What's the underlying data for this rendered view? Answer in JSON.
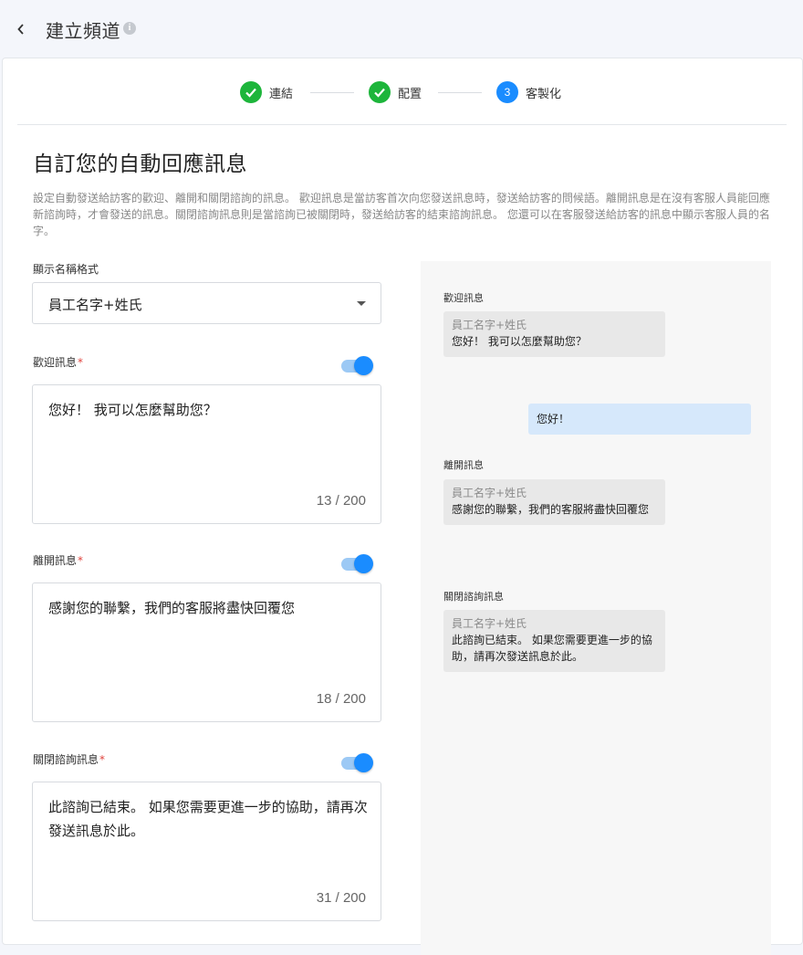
{
  "header": {
    "title": "建立頻道",
    "back_icon": "chevron-left-icon",
    "info_icon": "info-icon"
  },
  "stepper": {
    "steps": [
      {
        "label": "連結",
        "state": "done"
      },
      {
        "label": "配置",
        "state": "done"
      },
      {
        "label": "客製化",
        "state": "active",
        "number": "3"
      }
    ],
    "done_color": "#1db53b",
    "active_color": "#1a8cff"
  },
  "main": {
    "title": "自訂您的自動回應訊息",
    "description": "設定自動發送給訪客的歡迎、離開和關閉諮詢的訊息。 歡迎訊息是當訪客首次向您發送訊息時，發送給訪客的問候語。離開訊息是在沒有客服人員能回應新諮詢時，才會發送的訊息。關閉諮詢訊息則是當諮詢已被關閉時，發送給訪客的結束諮詢訊息。 您還可以在客服發送給訪客的訊息中顯示客服人員的名字。"
  },
  "form": {
    "display_name": {
      "label": "顯示名稱格式",
      "value": "員工名字+姓氏"
    },
    "welcome": {
      "label": "歡迎訊息",
      "required_mark": "*",
      "enabled": true,
      "text": "您好！ 我可以怎麼幫助您？",
      "counter": "13 / 200"
    },
    "away": {
      "label": "離開訊息",
      "required_mark": "*",
      "enabled": true,
      "text": "感謝您的聯繫，我們的客服將盡快回覆您",
      "counter": "18 / 200"
    },
    "close": {
      "label": "關閉諮詢訊息",
      "required_mark": "*",
      "enabled": true,
      "text": "此諮詢已結束。 如果您需要更進一步的協助，請再次發送訊息於此。",
      "counter": "31 / 200"
    },
    "toggle_color": "#1a8cff"
  },
  "preview": {
    "welcome": {
      "label": "歡迎訊息",
      "agent_name": "員工名字+姓氏",
      "text": "您好！ 我可以怎麼幫助您？"
    },
    "visitor_reply": "您好！",
    "away": {
      "label": "離開訊息",
      "agent_name": "員工名字+姓氏",
      "text": "感謝您的聯繫，我們的客服將盡快回覆您"
    },
    "close": {
      "label": "關閉諮詢訊息",
      "agent_name": "員工名字+姓氏",
      "text": "此諮詢已結束。 如果您需要更進一步的協助，請再次發送訊息於此。"
    },
    "visitor_bubble_color": "#d6e8fb",
    "agent_bubble_color": "#e8e8e8"
  }
}
